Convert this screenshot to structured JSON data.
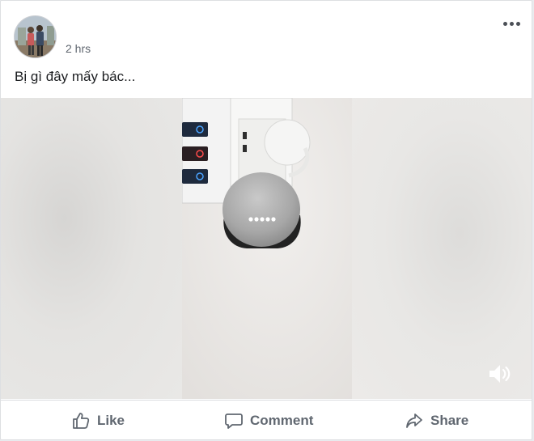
{
  "post": {
    "timestamp": "2 hrs",
    "text": "Bị gì đây mấy bác...",
    "more_icon": "more-horizontal-icon",
    "actions": [
      {
        "label": "Like",
        "icon": "thumbs-up-icon"
      },
      {
        "label": "Comment",
        "icon": "comment-icon"
      },
      {
        "label": "Share",
        "icon": "share-arrow-icon"
      }
    ],
    "video": {
      "sound_icon": "speaker-icon"
    }
  },
  "colors": {
    "text_primary": "#1c1e21",
    "text_secondary": "#606770",
    "border": "#dddfe2"
  }
}
